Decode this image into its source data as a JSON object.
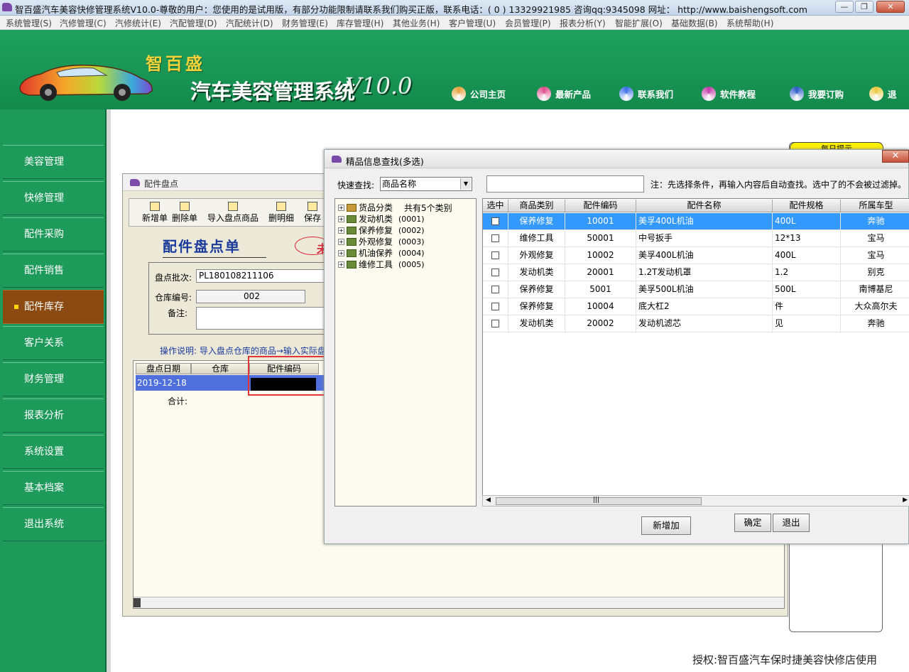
{
  "window": {
    "title": "智百盛汽车美容快修管理系统V10.0-尊敬的用户：您使用的是试用版，有部分功能限制请联系我们购买正版，联系电话：( 0 ) 13329921985  咨询qq:9345098   网址： http://www.baishengsoft.com",
    "min": "—",
    "max": "❐",
    "close": "✕"
  },
  "menu": [
    "系统管理(S)",
    "汽修管理(C)",
    "汽修统计(E)",
    "汽配管理(D)",
    "汽配统计(D)",
    "财务管理(E)",
    "库存管理(H)",
    "其他业务(H)",
    "客户管理(U)",
    "会员管理(P)",
    "报表分析(Y)",
    "智能扩展(O)",
    "基础数据(B)",
    "系统帮助(H)"
  ],
  "header": {
    "brand": "智百盛",
    "title": "汽车美容管理系统",
    "version": "V10.0",
    "links": [
      {
        "label": "公司主页",
        "icon": "pie-icon",
        "color": "#e8a13a"
      },
      {
        "label": "最新产品",
        "icon": "flower-icon",
        "color": "#e04a8a"
      },
      {
        "label": "联系我们",
        "icon": "people-icon",
        "color": "#3a6ee8"
      },
      {
        "label": "软件教程",
        "icon": "butterfly-icon",
        "color": "#c23aa8"
      },
      {
        "label": "我要订购",
        "icon": "cart-icon",
        "color": "#2a5ac8"
      },
      {
        "label": "退",
        "icon": "exit-icon",
        "color": "#e8c83a"
      }
    ]
  },
  "sidebar": {
    "items": [
      "美容管理",
      "快修管理",
      "配件采购",
      "配件销售",
      "配件库存",
      "客户关系",
      "财务管理",
      "报表分析",
      "系统设置",
      "基本档案",
      "退出系统"
    ],
    "active_index": 4
  },
  "right_panel": {
    "tab": "每日提示"
  },
  "bg_window": {
    "title": "配件盘点",
    "toolbar": [
      "新增单",
      "删除单",
      "导入盘点商品",
      "删明细",
      "保存"
    ],
    "form_title": "配件盘点单",
    "stamp": "未",
    "batch_label": "盘点批次:",
    "batch_value": "PL180108211106",
    "warehouse_label": "仓库编号:",
    "warehouse_value": "002",
    "remark_label": "备注:",
    "note": "操作说明: 导入盘点仓库的商品→输入实际盘",
    "grid_headers": [
      "盘点日期",
      "仓库",
      "配件编码"
    ],
    "row_date": "2019-12-18",
    "total_label": "合计:"
  },
  "dialog": {
    "title": "精品信息查找(多选)",
    "close": "✕",
    "quick_label": "快速查找:",
    "quick_value": "商品名称",
    "hint": "注：先选择条件，再输入内容后自动查找。选中了的不会被过滤掉。",
    "tree": {
      "root": "货品分类",
      "root_count": "共有5个类别",
      "nodes": [
        {
          "name": "发动机类",
          "code": "(0001)"
        },
        {
          "name": "保养修复",
          "code": "(0002)"
        },
        {
          "name": "外观修复",
          "code": "(0003)"
        },
        {
          "name": "机油保养",
          "code": "(0004)"
        },
        {
          "name": "维修工具",
          "code": "(0005)"
        }
      ]
    },
    "columns": [
      "选中",
      "商品类别",
      "配件编码",
      "配件名称",
      "配件规格",
      "所属车型"
    ],
    "rows": [
      {
        "cat": "保养修复",
        "code": "10001",
        "name": "美孚400L机油",
        "spec": "400L",
        "model": "奔驰",
        "selected": true
      },
      {
        "cat": "维修工具",
        "code": "50001",
        "name": "中号扳手",
        "spec": "12*13",
        "model": "宝马",
        "selected": false
      },
      {
        "cat": "外观修复",
        "code": "10002",
        "name": "美孚400L机油",
        "spec": "400L",
        "model": "宝马",
        "selected": false
      },
      {
        "cat": "发动机类",
        "code": "20001",
        "name": "1.2T发动机罩",
        "spec": "1.2",
        "model": "别克",
        "selected": false
      },
      {
        "cat": "保养修复",
        "code": "5001",
        "name": "美孚500L机油",
        "spec": "500L",
        "model": "南博基尼",
        "selected": false
      },
      {
        "cat": "保养修复",
        "code": "10004",
        "name": "底大杠2",
        "spec": "件",
        "model": "大众高尔夫",
        "selected": false
      },
      {
        "cat": "发动机类",
        "code": "20002",
        "name": "发动机滤芯",
        "spec": "见",
        "model": "奔驰",
        "selected": false
      }
    ],
    "scroll_grip": "|||",
    "btn_add": "新增加",
    "btn_ok": "确定",
    "btn_exit": "退出"
  },
  "footer": "授权:智百盛汽车保时捷美容快修店使用"
}
